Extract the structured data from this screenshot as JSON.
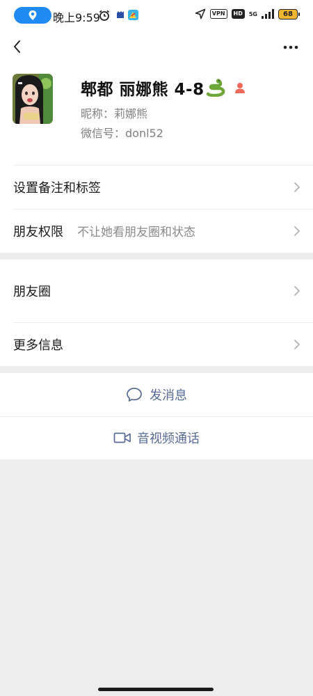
{
  "status_bar": {
    "time": "晚上9:59",
    "vpn": "VPN",
    "hd": "HD",
    "network": "5G",
    "battery": "68"
  },
  "profile": {
    "name": "郫都  丽娜熊 4-8",
    "nickname": "昵称：莉娜熊",
    "wechat_id": "微信号：donl52",
    "gender": "female"
  },
  "rows": {
    "remark": {
      "label": "设置备注和标签"
    },
    "permission": {
      "label": "朋友权限",
      "value": "不让她看朋友圈和状态"
    },
    "moments": {
      "label": "朋友圈"
    },
    "more_info": {
      "label": "更多信息"
    }
  },
  "actions": {
    "message": {
      "label": "发消息",
      "icon": "chat-bubble-icon"
    },
    "call": {
      "label": "音视频通话",
      "icon": "video-camera-icon"
    }
  },
  "colors": {
    "link": "#576b95",
    "location_pill": "#1f8bf2",
    "battery": "#f2b731",
    "background": "#ededed"
  }
}
